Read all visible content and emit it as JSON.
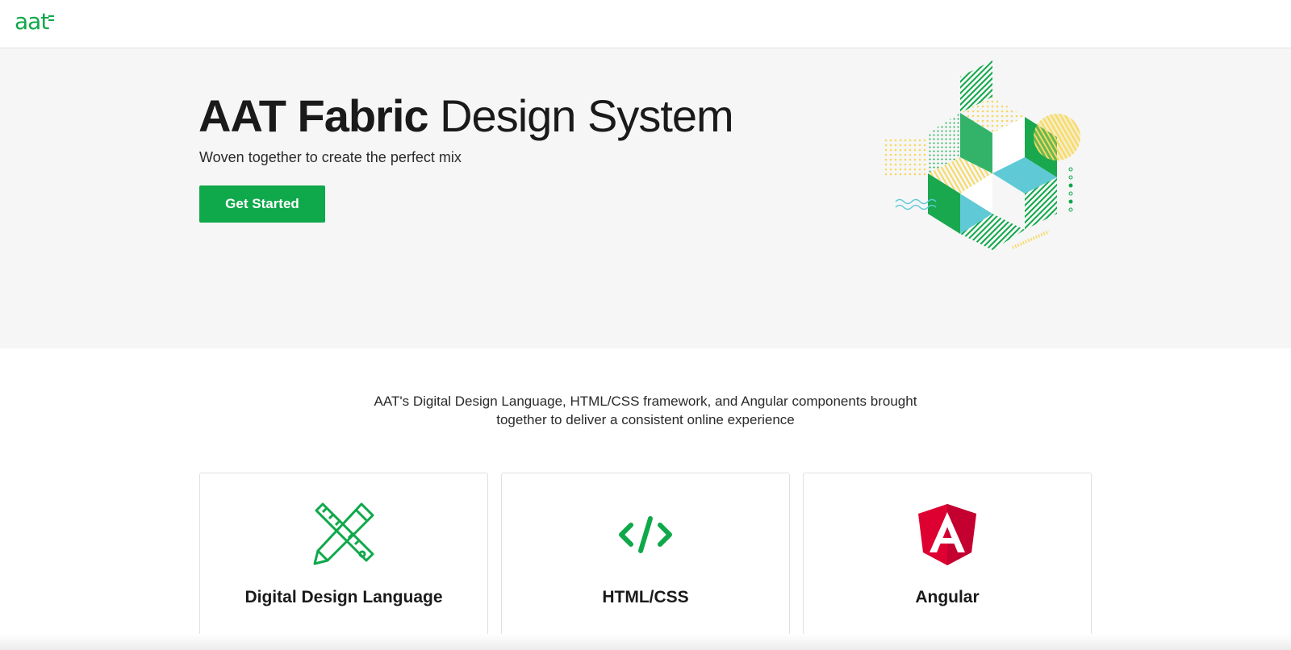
{
  "header": {
    "logo_text": "aat"
  },
  "hero": {
    "title_bold": "AAT Fabric",
    "title_light": "Design System",
    "subtitle": "Woven together to create the perfect mix",
    "cta_label": "Get Started"
  },
  "intro": {
    "line1": "AAT's Digital Design Language, HTML/CSS framework, and Angular components brought",
    "line2": "together to deliver a consistent online experience"
  },
  "cards": [
    {
      "label": "Digital Design Language",
      "icon": "ruler-pencil-icon"
    },
    {
      "label": "HTML/CSS",
      "icon": "code-icon"
    },
    {
      "label": "Angular",
      "icon": "angular-logo-icon"
    }
  ],
  "colors": {
    "brand_green": "#0fa84a",
    "hero_bg": "#f6f6f6",
    "angular_red": "#dd0031",
    "accent_yellow": "#f6d960",
    "accent_teal": "#5fcad6"
  }
}
